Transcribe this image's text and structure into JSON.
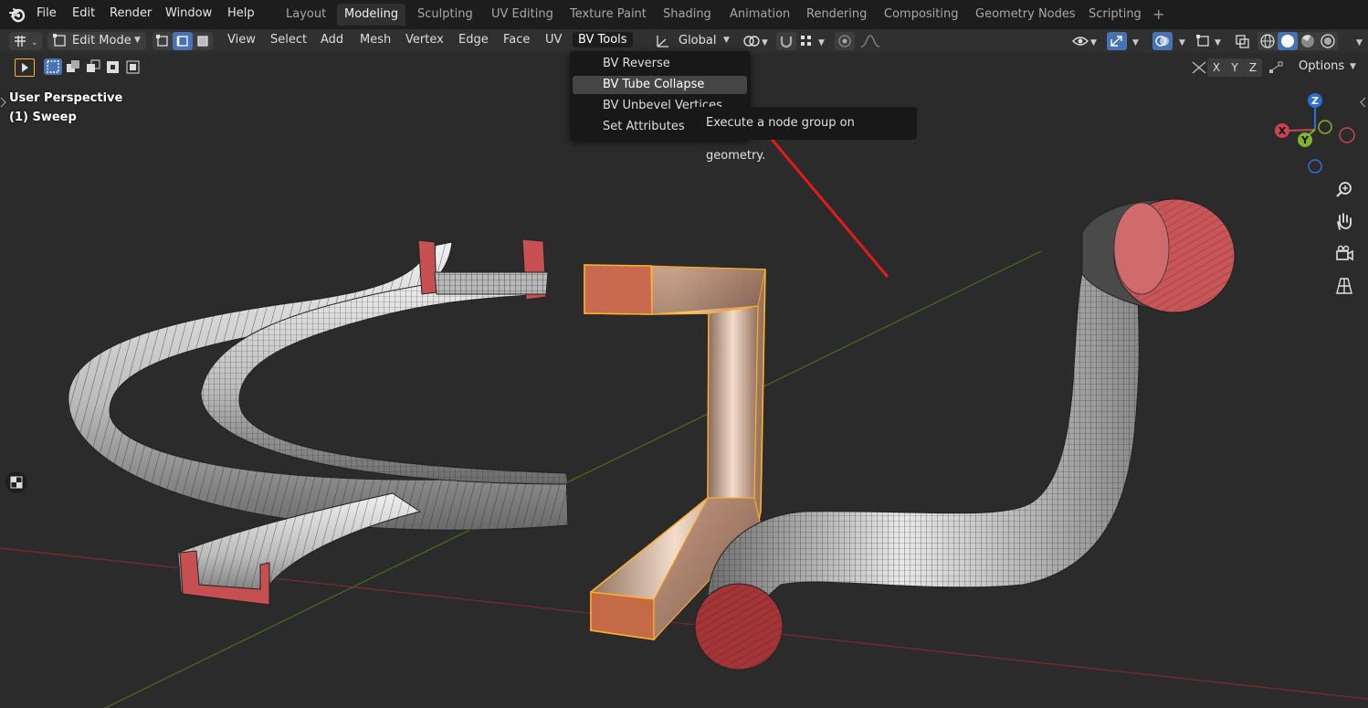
{
  "topbar": {
    "menus": [
      "File",
      "Edit",
      "Render",
      "Window",
      "Help"
    ],
    "workspaces": [
      "Layout",
      "Modeling",
      "Sculpting",
      "UV Editing",
      "Texture Paint",
      "Shading",
      "Animation",
      "Rendering",
      "Compositing",
      "Geometry Nodes",
      "Scripting"
    ],
    "active_workspace": "Modeling",
    "add_tab": "+"
  },
  "header": {
    "mode": "Edit Mode",
    "menus": [
      "View",
      "Select",
      "Add",
      "Mesh",
      "Vertex",
      "Edge",
      "Face",
      "UV",
      "BV Tools"
    ],
    "open_menu": "BV Tools",
    "orientation": "Global",
    "options": "Options",
    "axes": [
      "X",
      "Y",
      "Z"
    ]
  },
  "viewport": {
    "perspective": "User Perspective",
    "object": "(1) Sweep"
  },
  "dropdown": {
    "items": [
      "BV Reverse",
      "BV Tube Collapse",
      "BV Unbevel Vertices",
      "Set Attributes"
    ],
    "highlighted": "BV Tube Collapse"
  },
  "tooltip": {
    "text": "Execute a node group on geometry."
  },
  "gizmo": {
    "z": "Z",
    "x": "X",
    "y": "Y"
  },
  "colors": {
    "accent": "#4772b3",
    "arrow": "#e21c1c",
    "selected": "#ffb12e",
    "face_red": "#c84f50"
  }
}
